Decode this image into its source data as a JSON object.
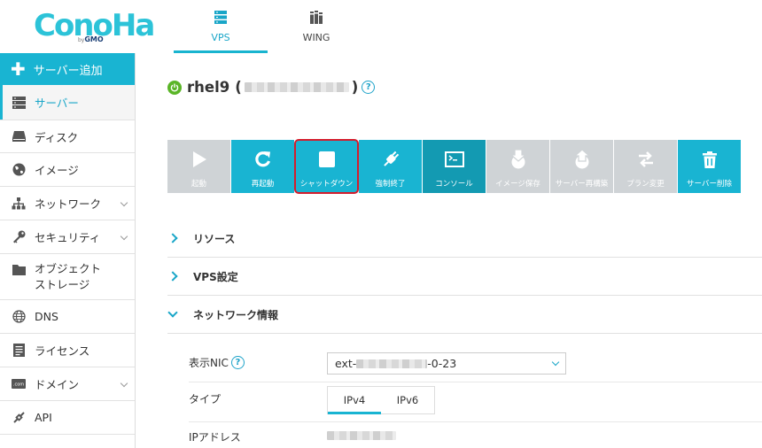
{
  "header": {
    "logo_text": "ConoHa",
    "logo_sub_by": "by",
    "logo_sub": "GMO",
    "nav": [
      {
        "label": "VPS",
        "icon": "server-icon",
        "active": true
      },
      {
        "label": "WING",
        "icon": "books-icon",
        "active": false
      }
    ]
  },
  "sidebar": {
    "add_label": "サーバー追加",
    "items": [
      {
        "label": "サーバー",
        "icon": "server-list-icon",
        "active": true
      },
      {
        "label": "ディスク",
        "icon": "disk-icon"
      },
      {
        "label": "イメージ",
        "icon": "globe-icon"
      },
      {
        "label": "ネットワーク",
        "icon": "network-icon",
        "expandable": true
      },
      {
        "label": "セキュリティ",
        "icon": "key-icon",
        "expandable": true
      },
      {
        "label": "オブジェクト",
        "label2": "ストレージ",
        "icon": "folder-icon"
      },
      {
        "label": "DNS",
        "icon": "dns-icon"
      },
      {
        "label": "ライセンス",
        "icon": "license-icon"
      },
      {
        "label": "ドメイン",
        "icon": "domain-icon",
        "expandable": true
      },
      {
        "label": "API",
        "icon": "api-icon"
      }
    ]
  },
  "server": {
    "name": "rhel9",
    "paren_open": "(",
    "paren_close": ")",
    "status": "running"
  },
  "toolbar": [
    {
      "label": "起動",
      "icon": "play-icon",
      "state": "disabled"
    },
    {
      "label": "再起動",
      "icon": "restart-icon",
      "state": "on"
    },
    {
      "label": "シャットダウン",
      "icon": "stop-icon",
      "state": "on",
      "highlight": true
    },
    {
      "label": "強制終了",
      "icon": "plug-icon",
      "state": "on"
    },
    {
      "label": "コンソール",
      "icon": "console-icon",
      "state": "dark"
    },
    {
      "label": "イメージ保存",
      "icon": "image-save-icon",
      "state": "disabled"
    },
    {
      "label": "サーバー再構築",
      "icon": "rebuild-icon",
      "state": "disabled"
    },
    {
      "label": "プラン変更",
      "icon": "plan-change-icon",
      "state": "disabled"
    },
    {
      "label": "サーバー削除",
      "icon": "trash-icon",
      "state": "on"
    }
  ],
  "sections": [
    {
      "label": "リソース",
      "expanded": false
    },
    {
      "label": "VPS設定",
      "expanded": false
    },
    {
      "label": "ネットワーク情報",
      "expanded": true
    }
  ],
  "network": {
    "nic_label": "表示NIC",
    "nic_value_prefix": "ext-",
    "nic_value_suffix": "-0-23",
    "type_label": "タイプ",
    "type_tabs": [
      "IPv4",
      "IPv6"
    ],
    "type_active": "IPv4",
    "ip_label": "IPアドレス"
  },
  "colors": {
    "accent": "#19b4d2",
    "accent_dark": "#139ab2",
    "disabled": "#cfd3d6",
    "status_running": "#5ab527",
    "highlight": "#d41c2c"
  }
}
